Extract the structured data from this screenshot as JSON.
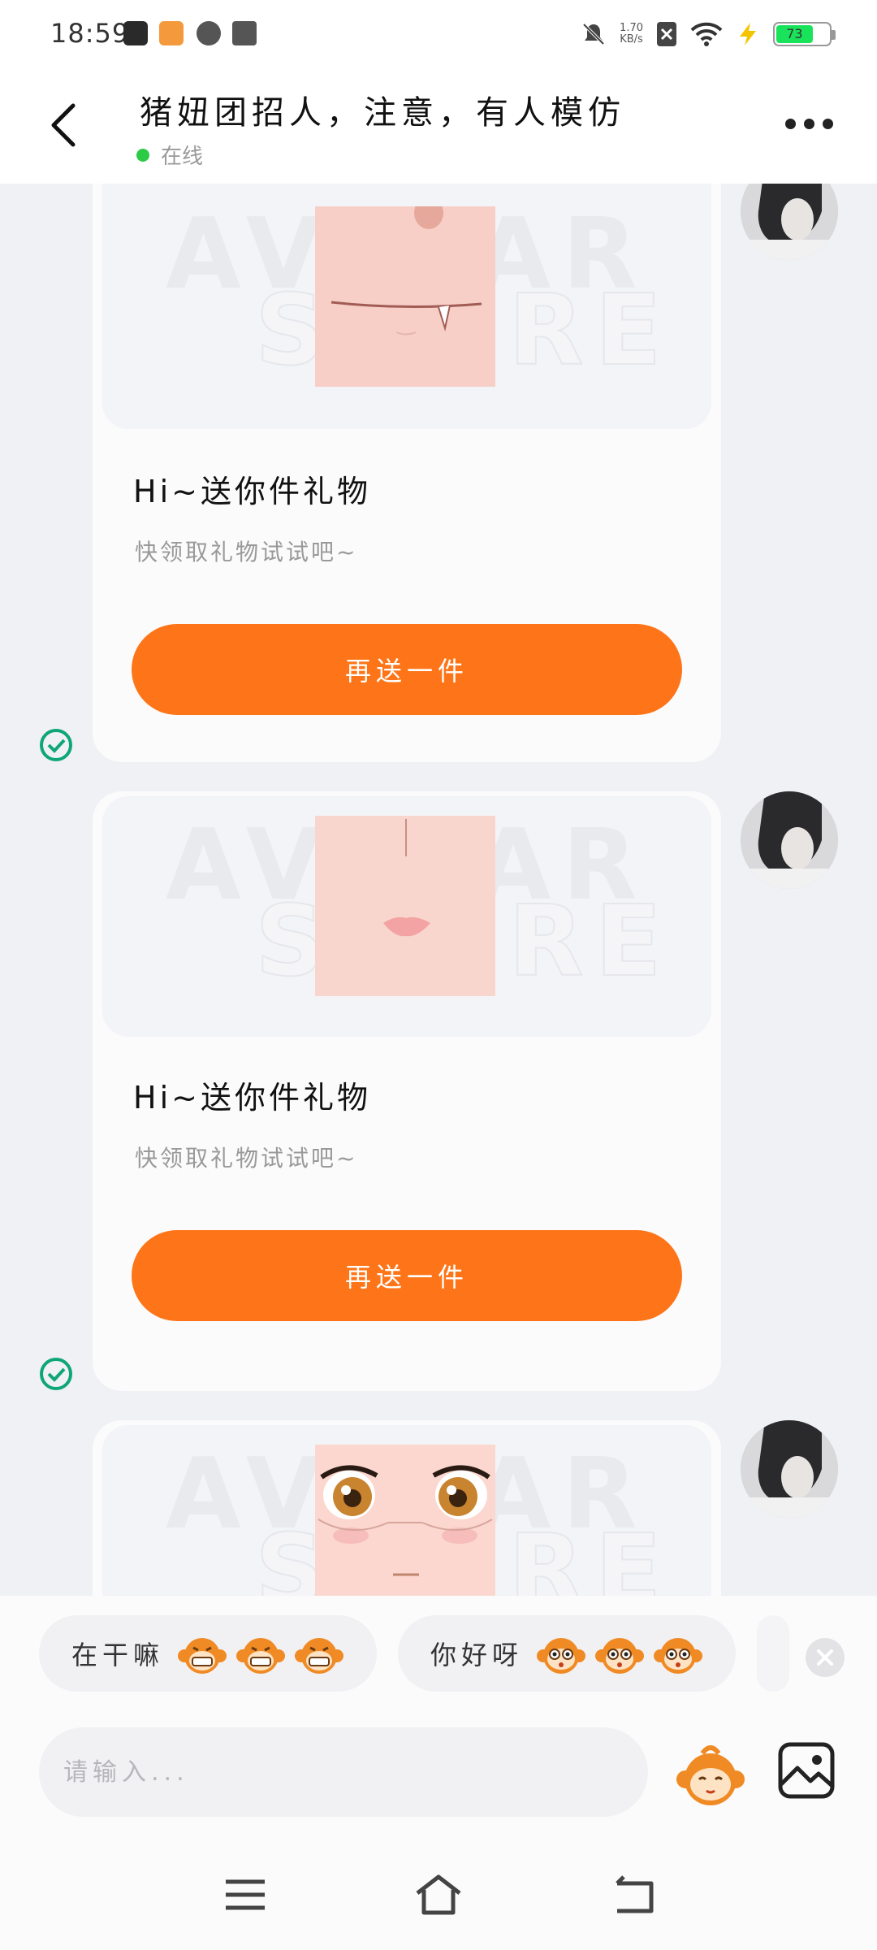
{
  "status_bar": {
    "time": "18:59",
    "net_speed_value": "1.70",
    "net_speed_unit": "KB/s",
    "battery": "73"
  },
  "header": {
    "title": "猪妞团招人，注意，有人模仿",
    "status": "在线"
  },
  "messages": [
    {
      "gift_title": "Hi~送你件礼物",
      "gift_subtitle": "快领取礼物试试吧~",
      "button_label": "再送一件",
      "watermark_1": "AVATAR",
      "watermark_2": "STORE"
    },
    {
      "gift_title": "Hi~送你件礼物",
      "gift_subtitle": "快领取礼物试试吧~",
      "button_label": "再送一件",
      "watermark_1": "AVATAR",
      "watermark_2": "STORE"
    },
    {
      "watermark_1": "AVATAR",
      "watermark_2": "STORE"
    }
  ],
  "quick_replies": [
    {
      "text": "在干嘛"
    },
    {
      "text": "你好呀"
    }
  ],
  "input": {
    "placeholder": "请输入..."
  },
  "colors": {
    "accent": "#fd7518",
    "online": "#2bcb46",
    "check": "#0fa676"
  }
}
